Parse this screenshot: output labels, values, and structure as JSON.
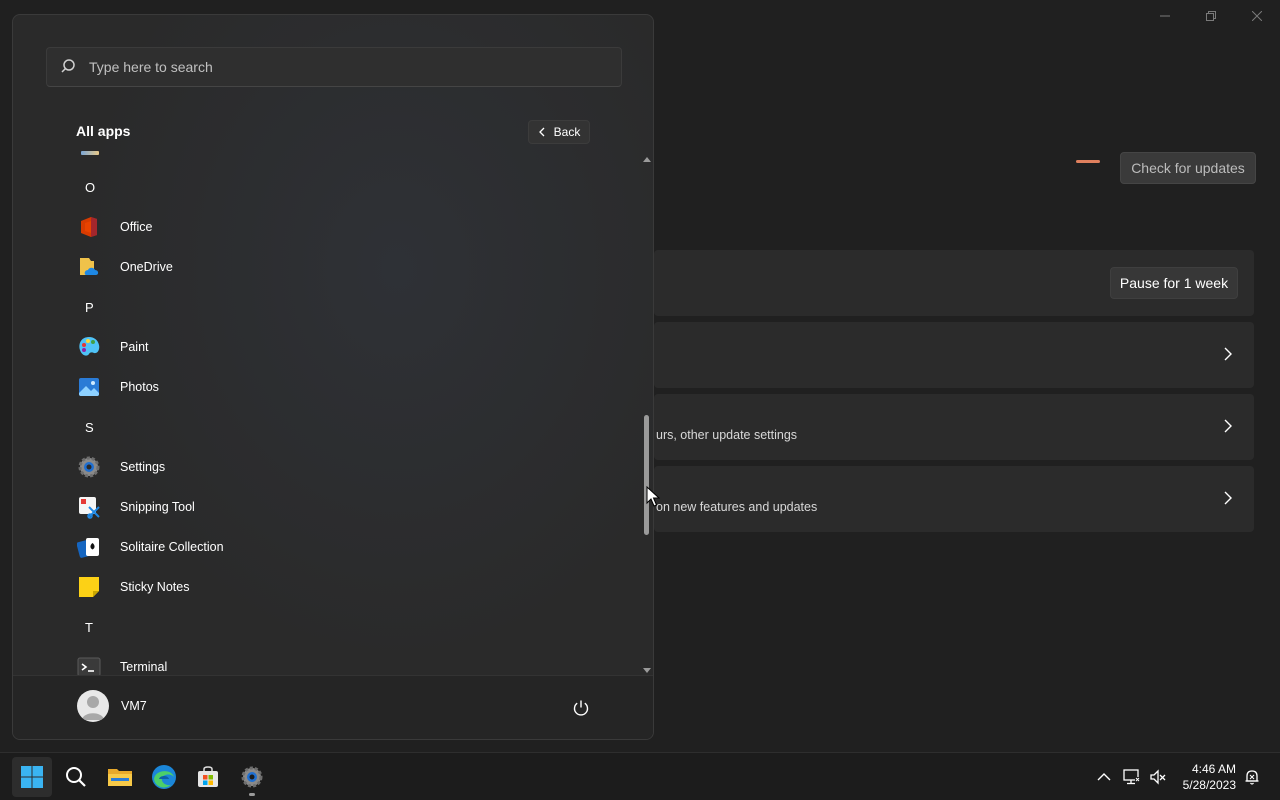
{
  "settings": {
    "check_updates_label": "Check for updates",
    "pause_label": "Pause for 1 week",
    "card3_subtext": "urs, other update settings",
    "card4_subtext": "on new features and updates",
    "accent_color": "#e0805e"
  },
  "start_menu": {
    "search": {
      "placeholder": "Type here to search"
    },
    "all_apps_title": "All apps",
    "back_label": "Back",
    "items": [
      {
        "kind": "letter",
        "label": "O"
      },
      {
        "kind": "app",
        "label": "Office",
        "icon": "office-icon"
      },
      {
        "kind": "app",
        "label": "OneDrive",
        "icon": "onedrive-icon"
      },
      {
        "kind": "letter",
        "label": "P"
      },
      {
        "kind": "app",
        "label": "Paint",
        "icon": "paint-icon"
      },
      {
        "kind": "app",
        "label": "Photos",
        "icon": "photos-icon"
      },
      {
        "kind": "letter",
        "label": "S"
      },
      {
        "kind": "app",
        "label": "Settings",
        "icon": "settings-icon"
      },
      {
        "kind": "app",
        "label": "Snipping Tool",
        "icon": "snipping-tool-icon"
      },
      {
        "kind": "app",
        "label": "Solitaire Collection",
        "icon": "solitaire-icon"
      },
      {
        "kind": "app",
        "label": "Sticky Notes",
        "icon": "sticky-notes-icon"
      },
      {
        "kind": "letter",
        "label": "T"
      },
      {
        "kind": "app",
        "label": "Terminal",
        "icon": "terminal-icon"
      }
    ],
    "user": {
      "name": "VM7"
    }
  },
  "taskbar": {
    "pinned": [
      "start-icon",
      "search-icon",
      "file-explorer-icon",
      "edge-icon",
      "store-icon",
      "settings-icon"
    ],
    "clock": {
      "time": "4:46 AM",
      "date": "5/28/2023"
    }
  }
}
